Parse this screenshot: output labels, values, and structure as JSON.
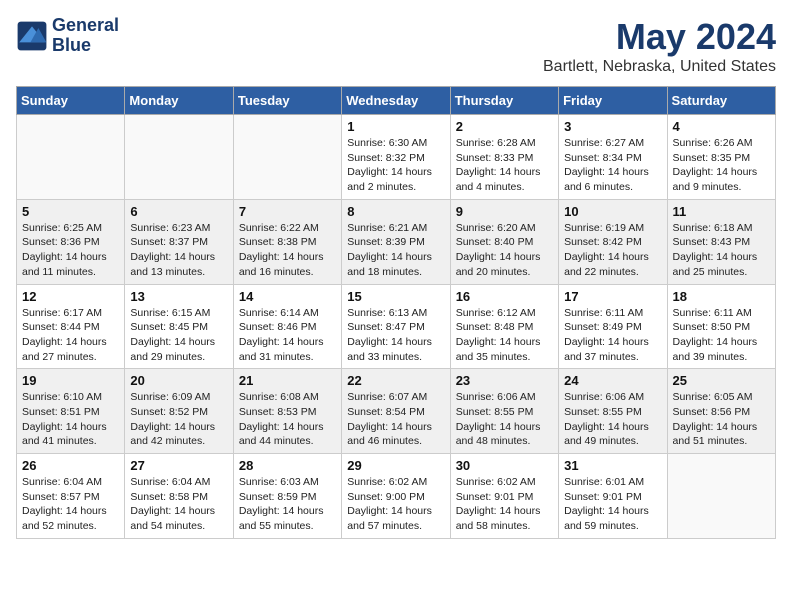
{
  "logo": {
    "line1": "General",
    "line2": "Blue"
  },
  "title": "May 2024",
  "subtitle": "Bartlett, Nebraska, United States",
  "days_of_week": [
    "Sunday",
    "Monday",
    "Tuesday",
    "Wednesday",
    "Thursday",
    "Friday",
    "Saturday"
  ],
  "weeks": [
    [
      {
        "day": "",
        "lines": []
      },
      {
        "day": "",
        "lines": []
      },
      {
        "day": "",
        "lines": []
      },
      {
        "day": "1",
        "lines": [
          "Sunrise: 6:30 AM",
          "Sunset: 8:32 PM",
          "Daylight: 14 hours",
          "and 2 minutes."
        ]
      },
      {
        "day": "2",
        "lines": [
          "Sunrise: 6:28 AM",
          "Sunset: 8:33 PM",
          "Daylight: 14 hours",
          "and 4 minutes."
        ]
      },
      {
        "day": "3",
        "lines": [
          "Sunrise: 6:27 AM",
          "Sunset: 8:34 PM",
          "Daylight: 14 hours",
          "and 6 minutes."
        ]
      },
      {
        "day": "4",
        "lines": [
          "Sunrise: 6:26 AM",
          "Sunset: 8:35 PM",
          "Daylight: 14 hours",
          "and 9 minutes."
        ]
      }
    ],
    [
      {
        "day": "5",
        "lines": [
          "Sunrise: 6:25 AM",
          "Sunset: 8:36 PM",
          "Daylight: 14 hours",
          "and 11 minutes."
        ]
      },
      {
        "day": "6",
        "lines": [
          "Sunrise: 6:23 AM",
          "Sunset: 8:37 PM",
          "Daylight: 14 hours",
          "and 13 minutes."
        ]
      },
      {
        "day": "7",
        "lines": [
          "Sunrise: 6:22 AM",
          "Sunset: 8:38 PM",
          "Daylight: 14 hours",
          "and 16 minutes."
        ]
      },
      {
        "day": "8",
        "lines": [
          "Sunrise: 6:21 AM",
          "Sunset: 8:39 PM",
          "Daylight: 14 hours",
          "and 18 minutes."
        ]
      },
      {
        "day": "9",
        "lines": [
          "Sunrise: 6:20 AM",
          "Sunset: 8:40 PM",
          "Daylight: 14 hours",
          "and 20 minutes."
        ]
      },
      {
        "day": "10",
        "lines": [
          "Sunrise: 6:19 AM",
          "Sunset: 8:42 PM",
          "Daylight: 14 hours",
          "and 22 minutes."
        ]
      },
      {
        "day": "11",
        "lines": [
          "Sunrise: 6:18 AM",
          "Sunset: 8:43 PM",
          "Daylight: 14 hours",
          "and 25 minutes."
        ]
      }
    ],
    [
      {
        "day": "12",
        "lines": [
          "Sunrise: 6:17 AM",
          "Sunset: 8:44 PM",
          "Daylight: 14 hours",
          "and 27 minutes."
        ]
      },
      {
        "day": "13",
        "lines": [
          "Sunrise: 6:15 AM",
          "Sunset: 8:45 PM",
          "Daylight: 14 hours",
          "and 29 minutes."
        ]
      },
      {
        "day": "14",
        "lines": [
          "Sunrise: 6:14 AM",
          "Sunset: 8:46 PM",
          "Daylight: 14 hours",
          "and 31 minutes."
        ]
      },
      {
        "day": "15",
        "lines": [
          "Sunrise: 6:13 AM",
          "Sunset: 8:47 PM",
          "Daylight: 14 hours",
          "and 33 minutes."
        ]
      },
      {
        "day": "16",
        "lines": [
          "Sunrise: 6:12 AM",
          "Sunset: 8:48 PM",
          "Daylight: 14 hours",
          "and 35 minutes."
        ]
      },
      {
        "day": "17",
        "lines": [
          "Sunrise: 6:11 AM",
          "Sunset: 8:49 PM",
          "Daylight: 14 hours",
          "and 37 minutes."
        ]
      },
      {
        "day": "18",
        "lines": [
          "Sunrise: 6:11 AM",
          "Sunset: 8:50 PM",
          "Daylight: 14 hours",
          "and 39 minutes."
        ]
      }
    ],
    [
      {
        "day": "19",
        "lines": [
          "Sunrise: 6:10 AM",
          "Sunset: 8:51 PM",
          "Daylight: 14 hours",
          "and 41 minutes."
        ]
      },
      {
        "day": "20",
        "lines": [
          "Sunrise: 6:09 AM",
          "Sunset: 8:52 PM",
          "Daylight: 14 hours",
          "and 42 minutes."
        ]
      },
      {
        "day": "21",
        "lines": [
          "Sunrise: 6:08 AM",
          "Sunset: 8:53 PM",
          "Daylight: 14 hours",
          "and 44 minutes."
        ]
      },
      {
        "day": "22",
        "lines": [
          "Sunrise: 6:07 AM",
          "Sunset: 8:54 PM",
          "Daylight: 14 hours",
          "and 46 minutes."
        ]
      },
      {
        "day": "23",
        "lines": [
          "Sunrise: 6:06 AM",
          "Sunset: 8:55 PM",
          "Daylight: 14 hours",
          "and 48 minutes."
        ]
      },
      {
        "day": "24",
        "lines": [
          "Sunrise: 6:06 AM",
          "Sunset: 8:55 PM",
          "Daylight: 14 hours",
          "and 49 minutes."
        ]
      },
      {
        "day": "25",
        "lines": [
          "Sunrise: 6:05 AM",
          "Sunset: 8:56 PM",
          "Daylight: 14 hours",
          "and 51 minutes."
        ]
      }
    ],
    [
      {
        "day": "26",
        "lines": [
          "Sunrise: 6:04 AM",
          "Sunset: 8:57 PM",
          "Daylight: 14 hours",
          "and 52 minutes."
        ]
      },
      {
        "day": "27",
        "lines": [
          "Sunrise: 6:04 AM",
          "Sunset: 8:58 PM",
          "Daylight: 14 hours",
          "and 54 minutes."
        ]
      },
      {
        "day": "28",
        "lines": [
          "Sunrise: 6:03 AM",
          "Sunset: 8:59 PM",
          "Daylight: 14 hours",
          "and 55 minutes."
        ]
      },
      {
        "day": "29",
        "lines": [
          "Sunrise: 6:02 AM",
          "Sunset: 9:00 PM",
          "Daylight: 14 hours",
          "and 57 minutes."
        ]
      },
      {
        "day": "30",
        "lines": [
          "Sunrise: 6:02 AM",
          "Sunset: 9:01 PM",
          "Daylight: 14 hours",
          "and 58 minutes."
        ]
      },
      {
        "day": "31",
        "lines": [
          "Sunrise: 6:01 AM",
          "Sunset: 9:01 PM",
          "Daylight: 14 hours",
          "and 59 minutes."
        ]
      },
      {
        "day": "",
        "lines": []
      }
    ]
  ]
}
